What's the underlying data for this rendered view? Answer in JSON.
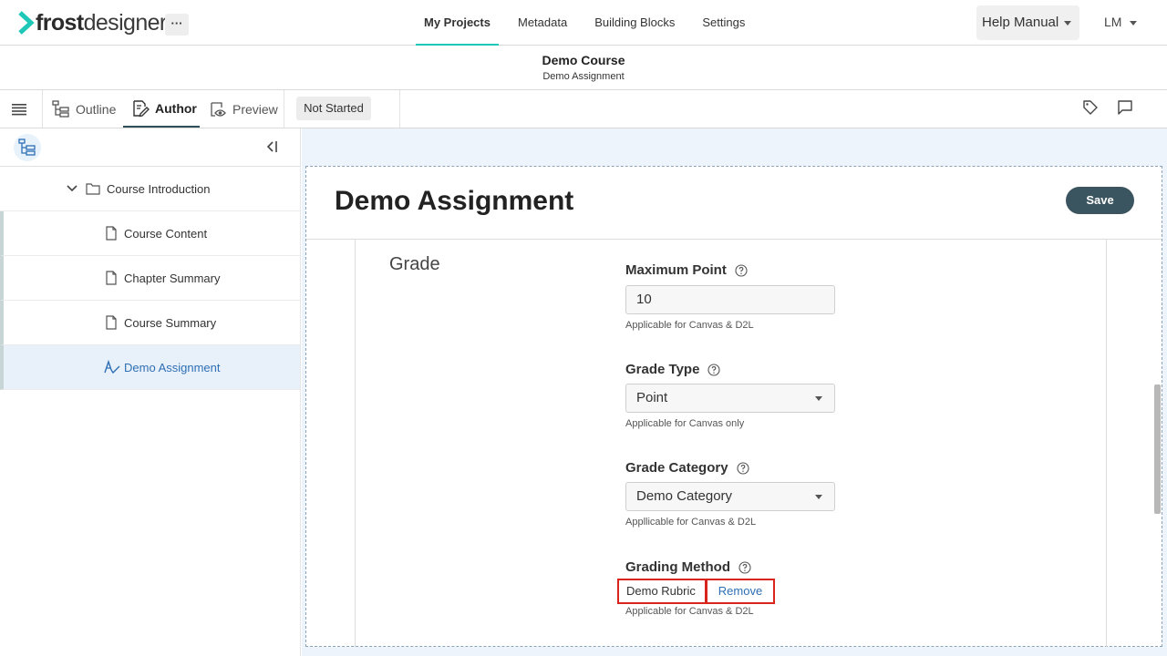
{
  "app": {
    "logo_bold": "frost",
    "logo_light": "designer",
    "more_label": "···"
  },
  "nav": {
    "tabs": [
      {
        "label": "My Projects"
      },
      {
        "label": "Metadata"
      },
      {
        "label": "Building Blocks"
      },
      {
        "label": "Settings"
      }
    ],
    "help_label": "Help Manual",
    "user_initials": "LM"
  },
  "course": {
    "title": "Demo Course",
    "subtitle": "Demo Assignment"
  },
  "toolbar": {
    "tabs": [
      {
        "label": "Outline",
        "icon": "outline-tree-icon"
      },
      {
        "label": "Author",
        "icon": "edit-icon"
      },
      {
        "label": "Preview",
        "icon": "preview-eye-icon"
      }
    ],
    "status": "Not Started",
    "right_icons": [
      "tag-icon",
      "comment-icon"
    ]
  },
  "sidebar": {
    "items": [
      {
        "label": "Course Introduction",
        "icon": "folder-icon",
        "expanded": true
      },
      {
        "label": "Course Content",
        "icon": "document-icon"
      },
      {
        "label": "Chapter Summary",
        "icon": "document-icon"
      },
      {
        "label": "Course Summary",
        "icon": "document-icon"
      },
      {
        "label": "Demo Assignment",
        "icon": "assignment-icon",
        "selected": true
      }
    ]
  },
  "editor": {
    "title": "Demo Assignment",
    "save_label": "Save",
    "section_title": "Grade",
    "fields": {
      "max_point": {
        "label": "Maximum Point",
        "value": "10",
        "hint": "Applicable for Canvas & D2L"
      },
      "grade_type": {
        "label": "Grade Type",
        "value": "Point",
        "hint": "Applicable for Canvas only"
      },
      "grade_category": {
        "label": "Grade Category",
        "value": "Demo Category",
        "hint": "Appllicable for Canvas & D2L"
      },
      "grading_method": {
        "label": "Grading Method",
        "value": "Demo Rubric",
        "remove_label": "Remove",
        "hint": "Applicable for Canvas & D2L"
      }
    }
  },
  "colors": {
    "accent": "#1ec8b8",
    "save_button": "#3a5560",
    "highlight_border": "#d9241c",
    "link": "#2e6fb5"
  }
}
